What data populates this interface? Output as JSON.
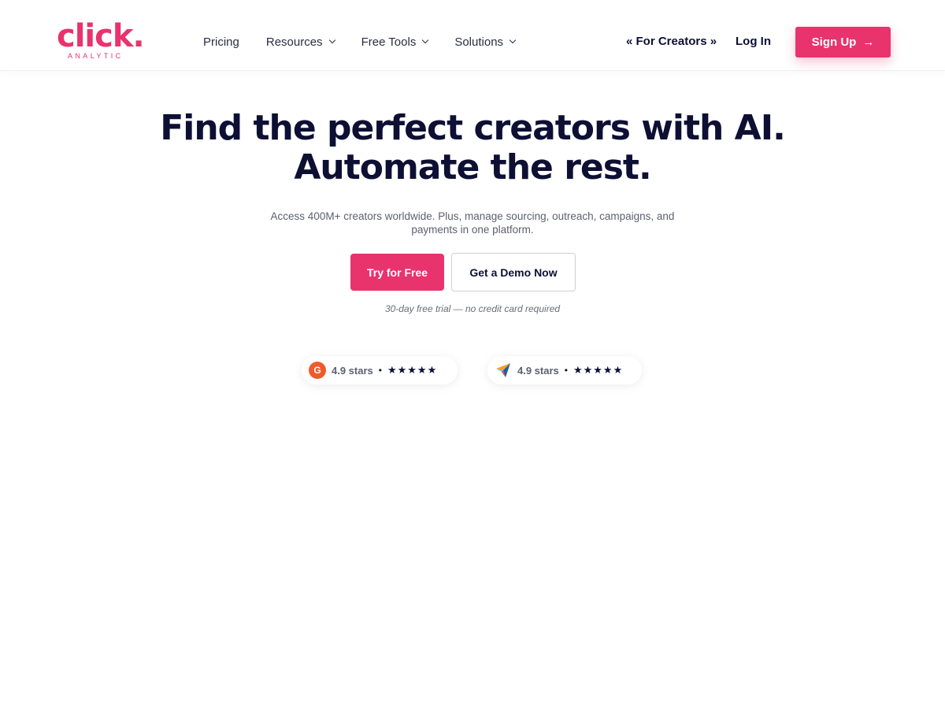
{
  "brand": {
    "name": "click.",
    "tagline": "ANALYTIC",
    "accent_color": "#e8336d"
  },
  "nav": {
    "items": [
      {
        "label": "Pricing",
        "has_dropdown": false
      },
      {
        "label": "Resources",
        "has_dropdown": true
      },
      {
        "label": "Free Tools",
        "has_dropdown": true
      },
      {
        "label": "Solutions",
        "has_dropdown": true
      }
    ],
    "for_creators": "« For Creators »",
    "login": "Log In",
    "signup": "Sign Up"
  },
  "hero": {
    "title_line1": "Find the perfect creators with AI.",
    "title_line2": "Automate the rest.",
    "subtitle_line1": "Access 400M+ creators worldwide. Plus, manage sourcing, outreach, campaigns, and",
    "subtitle_line2": "payments in one platform.",
    "cta_primary": "Try for Free",
    "cta_secondary": "Get a Demo Now",
    "trial_note": "30-day free trial — no credit card required"
  },
  "ratings": [
    {
      "icon": "g2-icon",
      "text": "4.9 stars",
      "stars": "★★★★★"
    },
    {
      "icon": "capterra-icon",
      "text": "4.9 stars",
      "stars": "★★★★★"
    }
  ]
}
